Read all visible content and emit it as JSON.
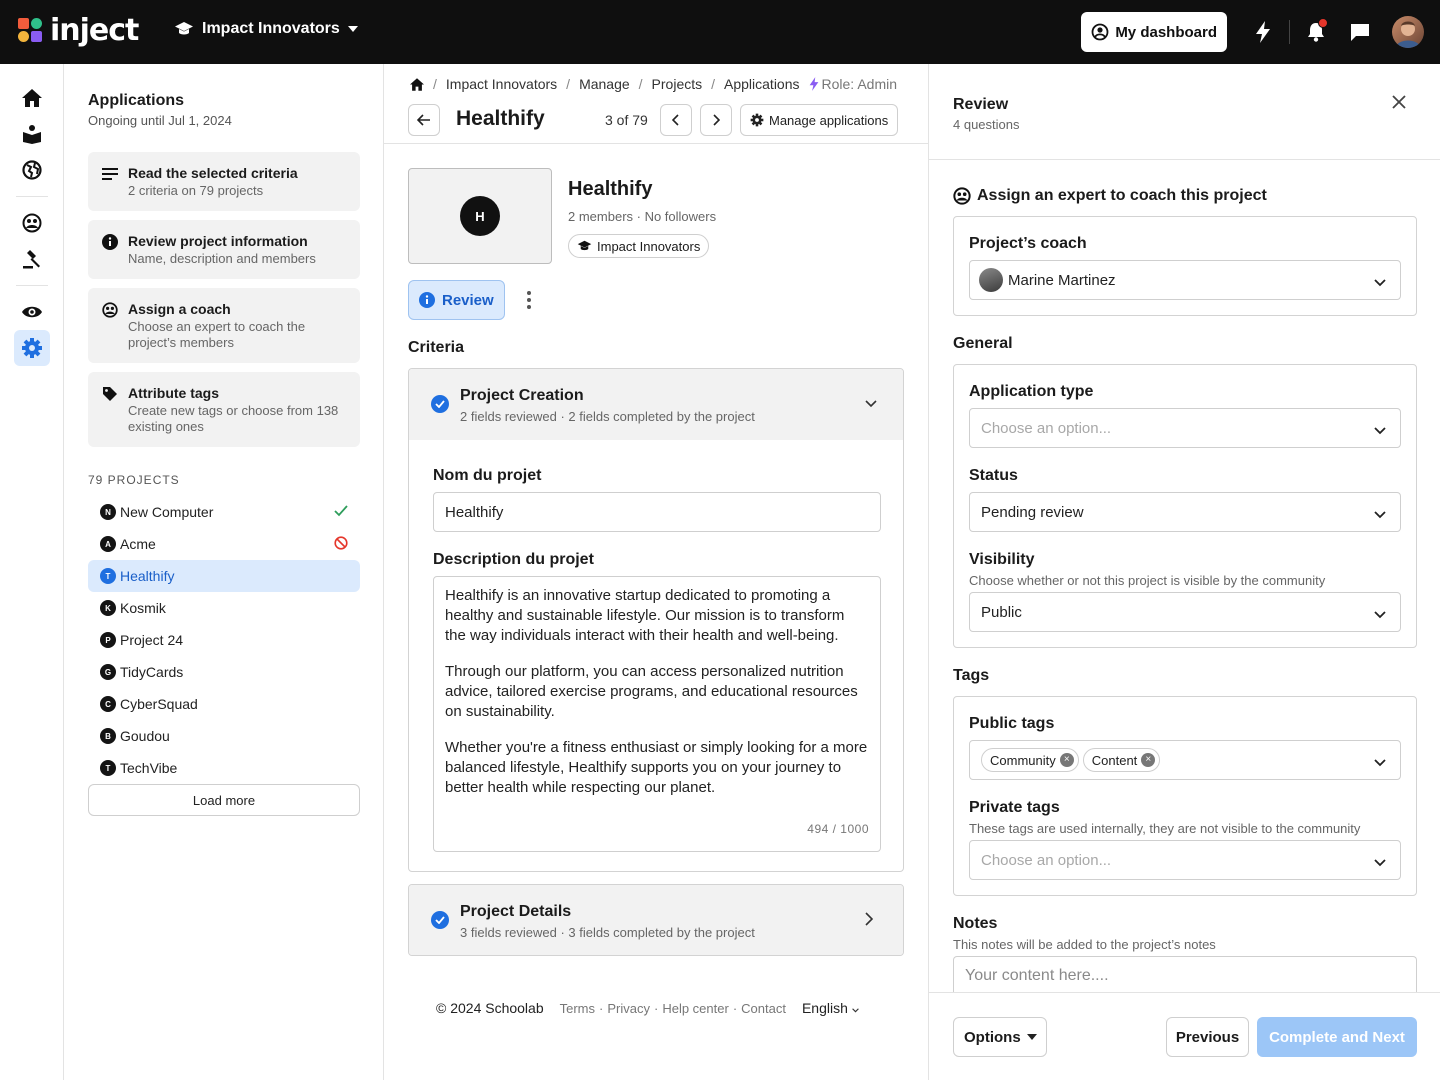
{
  "topbar": {
    "logo_text": "inject",
    "org_name": "Impact Innovators",
    "dashboard_label": "My dashboard"
  },
  "rail": {
    "icons": [
      "home-icon",
      "book-icon",
      "globe-icon",
      "coach-icon",
      "gavel-icon",
      "eye-icon",
      "gear-icon"
    ]
  },
  "left": {
    "title": "Applications",
    "subtitle": "Ongoing until Jul 1, 2024",
    "steps": [
      {
        "title": "Read the selected criteria",
        "desc": "2 criteria on 79 projects"
      },
      {
        "title": "Review project information",
        "desc": "Name, description and members"
      },
      {
        "title": "Assign a coach",
        "desc": "Choose an expert to coach the project’s members"
      },
      {
        "title": "Attribute tags",
        "desc": "Create new tags or choose from 138 existing ones"
      }
    ],
    "projects_header": "79 PROJECTS",
    "projects": [
      {
        "badge": "N",
        "name": "New Computer",
        "status": "done"
      },
      {
        "badge": "A",
        "name": "Acme",
        "status": "rejected"
      },
      {
        "badge": "T",
        "name": "Healthify",
        "status": "selected"
      },
      {
        "badge": "K",
        "name": "Kosmik",
        "status": ""
      },
      {
        "badge": "P",
        "name": "Project 24",
        "status": ""
      },
      {
        "badge": "G",
        "name": "TidyCards",
        "status": ""
      },
      {
        "badge": "C",
        "name": "CyberSquad",
        "status": ""
      },
      {
        "badge": "B",
        "name": "Goudou",
        "status": ""
      },
      {
        "badge": "T",
        "name": "TechVibe",
        "status": ""
      }
    ],
    "load_more": "Load more"
  },
  "center": {
    "breadcrumb": [
      "Impact Innovators",
      "Manage",
      "Projects",
      "Applications"
    ],
    "role": "Role: Admin",
    "title": "Healthify",
    "position": "3 of 79",
    "manage_label": "Manage applications",
    "project": {
      "initial": "H",
      "name": "Healthify",
      "meta": "2 members · No followers",
      "org_chip": "Impact Innovators"
    },
    "review_label": "Review",
    "criteria_title": "Criteria",
    "criteria": [
      {
        "title": "Project Creation",
        "desc": "2 fields reviewed · 2 fields completed by the project"
      },
      {
        "title": "Project Details",
        "desc": "3 fields reviewed · 3 fields completed by the project"
      }
    ],
    "fields": {
      "name_label": "Nom du projet",
      "name_value": "Healthify",
      "desc_label": "Description du projet",
      "desc_p1": "Healthify is an innovative startup dedicated to promoting a healthy and sustainable lifestyle. Our mission is to transform the way individuals interact with their health and well-being.",
      "desc_p2": "Through our platform, you can access personalized nutrition advice, tailored exercise programs, and educational resources on sustainability.",
      "desc_p3": "Whether you're a fitness enthusiast or simply looking for a more balanced lifestyle, Healthify supports you on your journey to better health while respecting our planet.",
      "desc_count": "494 / 1000"
    },
    "footer": {
      "copyright": "© 2024 Schoolab",
      "links": [
        "Terms",
        "Privacy",
        "Help center",
        "Contact"
      ],
      "language": "English"
    }
  },
  "review": {
    "title": "Review",
    "subtitle": "4 questions",
    "coach_section": "Assign an expert to coach this project",
    "coach_label": "Project’s coach",
    "coach_value": "Marine Martinez",
    "general_section": "General",
    "app_type_label": "Application type",
    "app_type_placeholder": "Choose an option...",
    "status_label": "Status",
    "status_value": "Pending review",
    "visibility_label": "Visibility",
    "visibility_hint": "Choose whether or not this project is visible by the community",
    "visibility_value": "Public",
    "tags_section": "Tags",
    "public_tags_label": "Public tags",
    "public_tags": [
      "Community",
      "Content"
    ],
    "private_tags_label": "Private tags",
    "private_tags_hint": "These tags are used internally, they are not visible to the community",
    "private_tags_placeholder": "Choose an option...",
    "notes_label": "Notes",
    "notes_hint": "This notes will be added to the project’s notes",
    "notes_placeholder": "Your content here....",
    "options_label": "Options",
    "previous_label": "Previous",
    "next_label": "Complete and Next"
  },
  "colors": {
    "accent": "#1f6fe0",
    "selected_bg": "#dbeafd",
    "disabled_primary": "#9cc6f7",
    "topbar": "#0f0f0f",
    "success": "#2e9d5b",
    "danger": "#e5362b"
  }
}
